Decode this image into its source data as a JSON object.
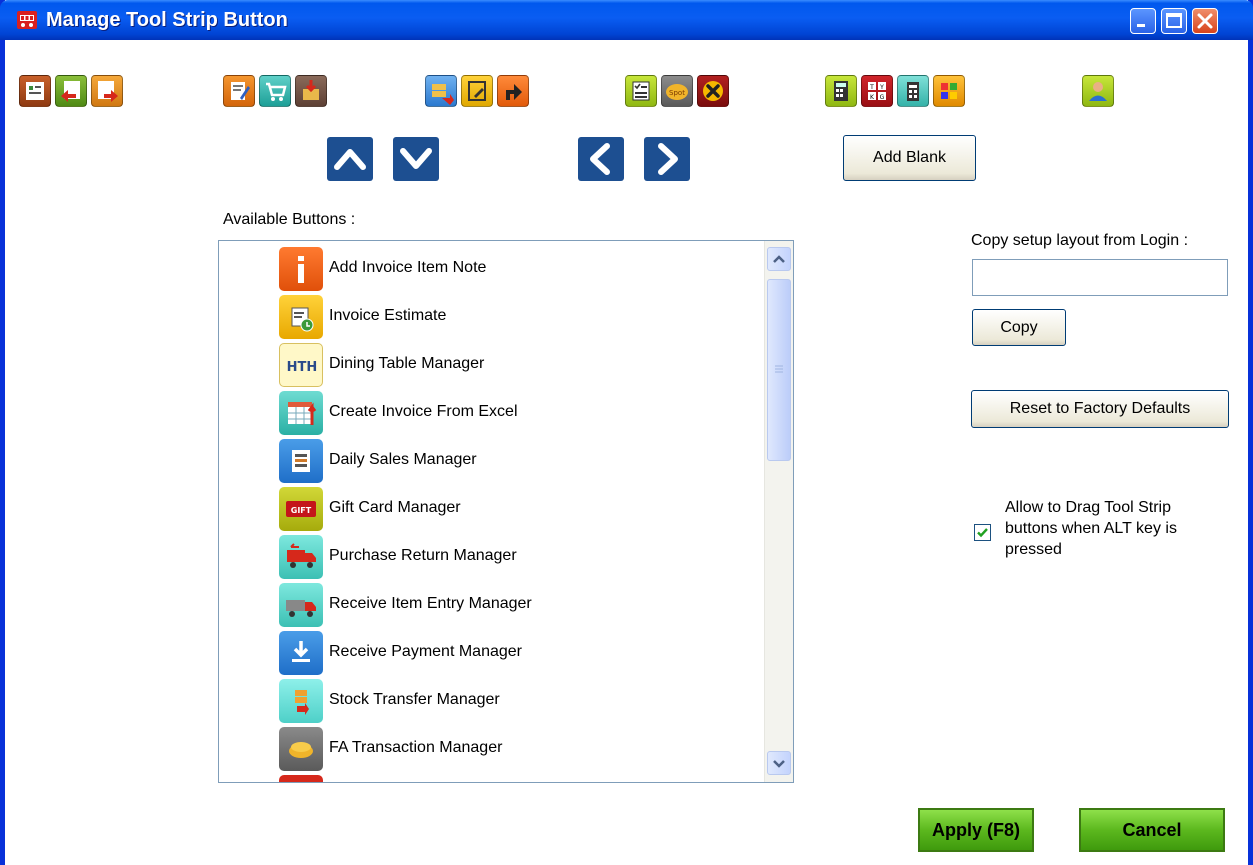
{
  "window": {
    "title": "Manage Tool Strip Button"
  },
  "controls": {
    "add_blank_label": "Add Blank"
  },
  "available": {
    "label": "Available  Buttons :",
    "items": [
      {
        "label": "Add Invoice Item Note",
        "icon": "info-icon"
      },
      {
        "label": "Invoice Estimate",
        "icon": "estimate-icon"
      },
      {
        "label": "Dining Table Manager",
        "icon": "dining-table-icon"
      },
      {
        "label": "Create Invoice From Excel",
        "icon": "excel-invoice-icon"
      },
      {
        "label": "Daily Sales Manager",
        "icon": "daily-sales-icon"
      },
      {
        "label": "Gift Card Manager",
        "icon": "gift-card-icon"
      },
      {
        "label": "Purchase Return Manager",
        "icon": "purchase-return-icon"
      },
      {
        "label": "Receive Item Entry Manager",
        "icon": "receive-item-truck-icon"
      },
      {
        "label": "Receive Payment Manager",
        "icon": "receive-payment-icon"
      },
      {
        "label": "Stock Transfer Manager",
        "icon": "stock-transfer-icon"
      },
      {
        "label": "FA Transaction Manager",
        "icon": "fa-transaction-icon"
      }
    ]
  },
  "copy_setup": {
    "label": "Copy setup layout from Login :",
    "value": "",
    "button_label": "Copy"
  },
  "reset": {
    "label": "Reset to Factory Defaults"
  },
  "drag_option": {
    "label_line1": "Allow to Drag Tool Strip",
    "label_line2": "buttons when ALT key is",
    "label_line3": "pressed",
    "checked": true
  },
  "footer": {
    "apply_label": "Apply (F8)",
    "cancel_label": "Cancel"
  },
  "colors": {
    "titlebar": "#0058ee",
    "nav_button": "#1d4f91",
    "green_button": "#5cb81e"
  }
}
